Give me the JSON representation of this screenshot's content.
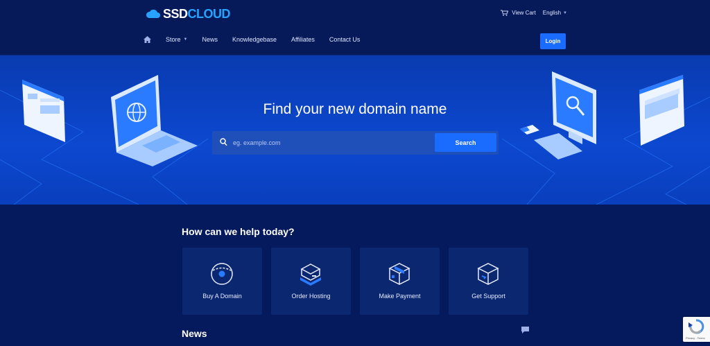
{
  "header": {
    "logo_main": "SSD",
    "logo_accent": "CLOUD",
    "view_cart": "View Cart",
    "language": "English",
    "login": "Login"
  },
  "nav": {
    "home_icon": "home-icon",
    "items": [
      {
        "label": "Store",
        "has_caret": true
      },
      {
        "label": "News"
      },
      {
        "label": "Knowledgebase"
      },
      {
        "label": "Affiliates"
      },
      {
        "label": "Contact Us"
      }
    ]
  },
  "hero": {
    "title": "Find your new domain name",
    "search_placeholder": "eg. example.com",
    "search_button": "Search"
  },
  "help": {
    "title": "How can we help today?",
    "cards": [
      {
        "label": "Buy A Domain",
        "icon": "globe-icon"
      },
      {
        "label": "Order Hosting",
        "icon": "server-box-icon"
      },
      {
        "label": "Make Payment",
        "icon": "package-icon"
      },
      {
        "label": "Get Support",
        "icon": "support-box-icon"
      }
    ]
  },
  "news": {
    "title": "News"
  },
  "recaptcha": {
    "text": "Privacy - Terms"
  },
  "colors": {
    "background": "#051a5c",
    "hero": "#0c48d0",
    "accent": "#1a6bff",
    "logo_accent": "#27a3ff",
    "card": "#0b2770"
  }
}
